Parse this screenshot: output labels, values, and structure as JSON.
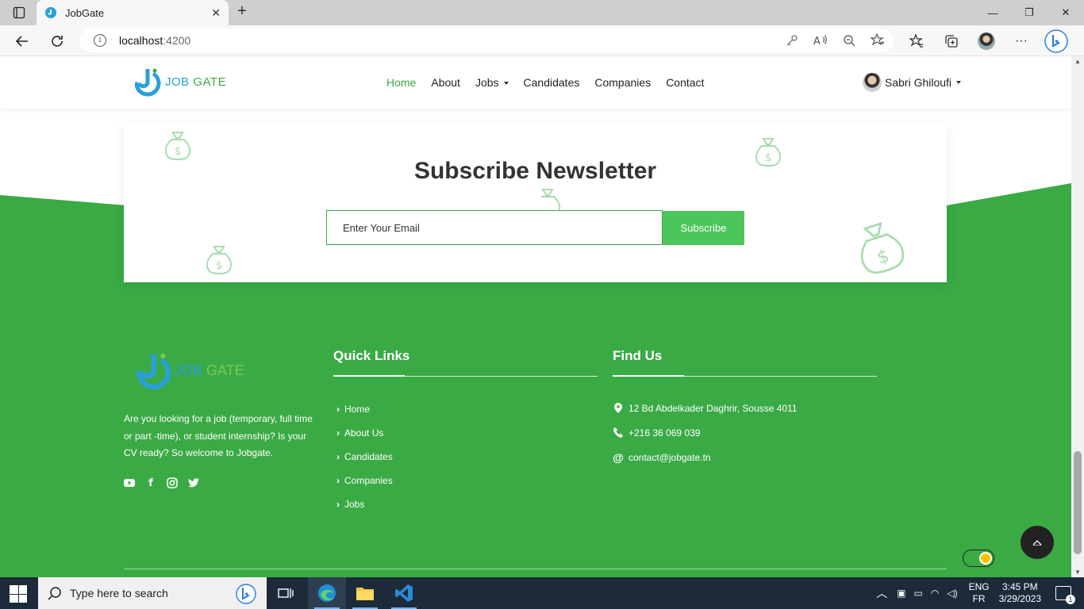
{
  "browser": {
    "tab_title": "JobGate",
    "address_host": "localhost",
    "address_port": ":4200"
  },
  "navbar": {
    "logo_text_a": "JOB",
    "logo_text_b": "GATE",
    "links": [
      "Home",
      "About",
      "Jobs",
      "Candidates",
      "Companies",
      "Contact"
    ],
    "active": "Home",
    "user_name": "Sabri Ghiloufi"
  },
  "newsletter": {
    "title": "Subscribe Newsletter",
    "placeholder": "Enter Your Email",
    "button": "Subscribe"
  },
  "footer": {
    "logo_text_a": "JOB",
    "logo_text_b": "GATE",
    "description": "Are you looking for a job (temporary, full time or part -time), or student internship? Is your CV ready? So welcome to Jobgate.",
    "quick_links_title": "Quick Links",
    "quick_links": [
      "Home",
      "About Us",
      "Candidates",
      "Companies",
      "Jobs"
    ],
    "find_us_title": "Find Us",
    "address": "12 Bd Abdelkader Daghrir, Sousse 4011",
    "phone": "+216 36 069 039",
    "email": "contact@jobgate.tn"
  },
  "taskbar": {
    "search_placeholder": "Type here to search",
    "lang_1": "ENG",
    "lang_2": "FR",
    "time": "3:45 PM",
    "date": "3/29/2023",
    "notification_count": "1"
  },
  "colors": {
    "brand_green": "#3aaa45",
    "brand_blue": "#2aa0d8"
  }
}
